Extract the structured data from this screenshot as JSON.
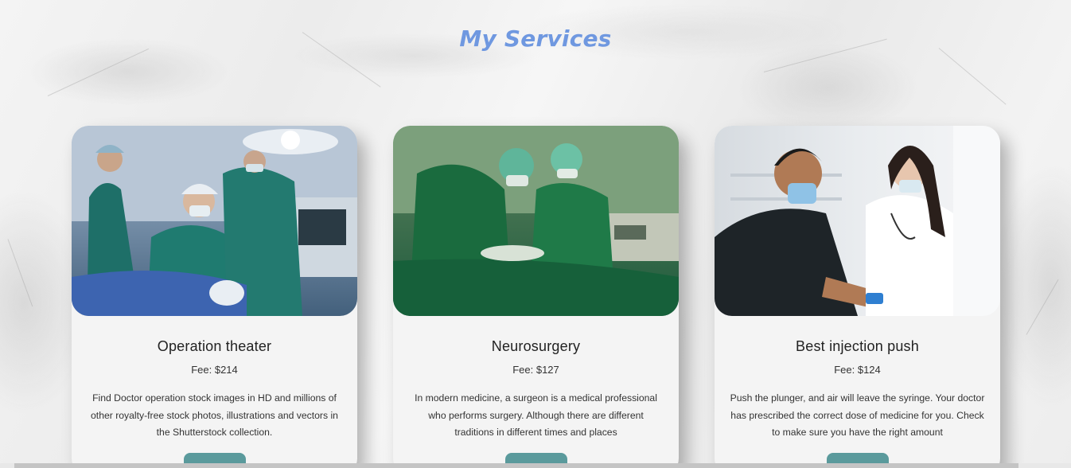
{
  "section": {
    "title": "My Services"
  },
  "cards": [
    {
      "image_alt": "surgical team in operation theater",
      "title": "Operation theater",
      "fee": "Fee: $214",
      "description": "Find Doctor operation stock images in HD and millions of other royalty-free stock photos, illustrations and vectors in the Shutterstock collection."
    },
    {
      "image_alt": "surgeons performing neurosurgery",
      "title": "Neurosurgery",
      "fee": "Fee: $127",
      "description": "In modern medicine, a surgeon is a medical professional who performs surgery. Although there are different traditions in different times and places"
    },
    {
      "image_alt": "doctor giving injection to patient",
      "title": "Best injection push",
      "fee": "Fee: $124",
      "description": "Push the plunger, and air will leave the syringe. Your doctor has prescribed the correct dose of medicine for you. Check to make sure you have the right amount"
    }
  ],
  "colors": {
    "title": "#6f98e0",
    "button": "#5a9a9c",
    "card_bg": "#f4f4f4"
  }
}
